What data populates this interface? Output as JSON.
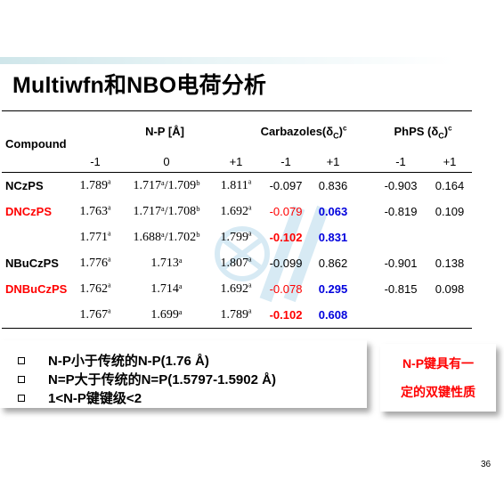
{
  "title": "Multiwfn和NBO电荷分析",
  "table": {
    "compound_header": "Compound",
    "np_header": "N-P [Å]",
    "carbazoles_header": "Carbazoles(δ",
    "carbazoles_sub": "C",
    "carbazoles_tail": ")",
    "carbazoles_sup": "c",
    "phps_header": "PhPS (δ",
    "phps_sub": "C",
    "phps_tail": ")",
    "phps_sup": "c",
    "subheaders": [
      "-1",
      "0",
      "+1",
      "-1",
      "+1",
      "-1",
      "+1"
    ],
    "rows": [
      {
        "name": "NCzPS",
        "np_m1": "1.789",
        "np_m1_sup": "a",
        "np_0": "1.717ᵃ/1.709ᵇ",
        "np_p1": "1.811",
        "np_p1_sup": "a",
        "cz_m1": "-0.097",
        "cz_p1": "0.836",
        "ph_m1": "-0.903",
        "ph_p1": "0.164"
      },
      {
        "name": "DNCzPS",
        "np_m1": "1.763",
        "np_m1_sup": "a",
        "np_0": "1.717ᵃ/1.708ᵇ",
        "np_p1": "1.692",
        "np_p1_sup": "a",
        "cz_m1": "-0.079",
        "cz_p1": "0.063",
        "ph_m1": "-0.819",
        "ph_p1": "0.109"
      },
      {
        "name": "",
        "np_m1": "1.771",
        "np_m1_sup": "a",
        "np_0": "1.688ᵃ/1.702ᵇ",
        "np_p1": "1.799",
        "np_p1_sup": "a",
        "cz_m1": "-0.102",
        "cz_p1": "0.831",
        "ph_m1": "",
        "ph_p1": ""
      },
      {
        "name": "NBuCzPS",
        "np_m1": "1.776",
        "np_m1_sup": "a",
        "np_0": "1.713ᵃ",
        "np_p1": "1.807",
        "np_p1_sup": "a",
        "cz_m1": "-0.099",
        "cz_p1": "0.862",
        "ph_m1": "-0.901",
        "ph_p1": "0.138"
      },
      {
        "name": "DNBuCzPS",
        "np_m1": "1.762",
        "np_m1_sup": "a",
        "np_0": "1.714ᵃ",
        "np_p1": "1.692",
        "np_p1_sup": "a",
        "cz_m1": "-0.078",
        "cz_p1": "0.295",
        "ph_m1": "-0.815",
        "ph_p1": "0.098"
      },
      {
        "name": "",
        "np_m1": "1.767",
        "np_m1_sup": "a",
        "np_0": "1.699ᵃ",
        "np_p1": "1.789",
        "np_p1_sup": "a",
        "cz_m1": "-0.102",
        "cz_p1": "0.608",
        "ph_m1": "",
        "ph_p1": ""
      }
    ]
  },
  "notes": [
    "N-P小于传统的N-P(1.76 Å)",
    "N=P大于传统的N=P(1.5797-1.5902 Å)",
    "1<N-P键键级<2"
  ],
  "callout": [
    "N-P键具有一",
    "定的双键性质"
  ],
  "page_number": "36",
  "colors": {
    "highlight_red": "#ff0000",
    "highlight_blue": "#0000dd"
  }
}
